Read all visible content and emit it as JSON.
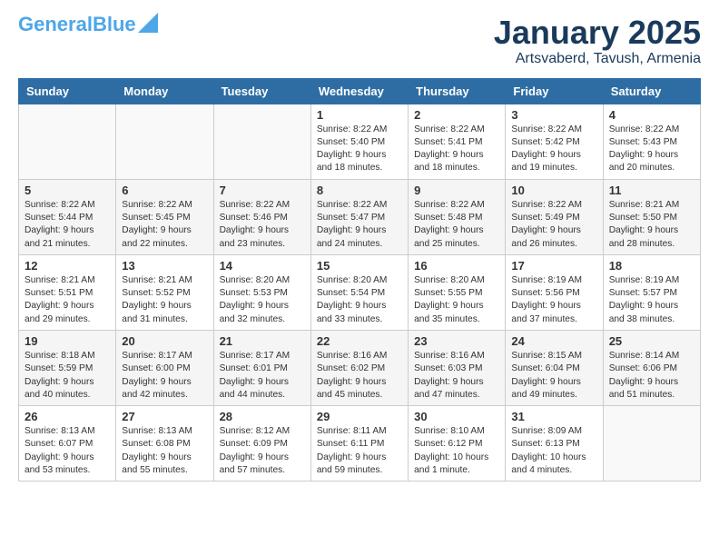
{
  "header": {
    "logo_line1": "General",
    "logo_line2": "Blue",
    "month": "January 2025",
    "location": "Artsvaberd, Tavush, Armenia"
  },
  "weekdays": [
    "Sunday",
    "Monday",
    "Tuesday",
    "Wednesday",
    "Thursday",
    "Friday",
    "Saturday"
  ],
  "weeks": [
    [
      {
        "day": "",
        "text": ""
      },
      {
        "day": "",
        "text": ""
      },
      {
        "day": "",
        "text": ""
      },
      {
        "day": "1",
        "text": "Sunrise: 8:22 AM\nSunset: 5:40 PM\nDaylight: 9 hours\nand 18 minutes."
      },
      {
        "day": "2",
        "text": "Sunrise: 8:22 AM\nSunset: 5:41 PM\nDaylight: 9 hours\nand 18 minutes."
      },
      {
        "day": "3",
        "text": "Sunrise: 8:22 AM\nSunset: 5:42 PM\nDaylight: 9 hours\nand 19 minutes."
      },
      {
        "day": "4",
        "text": "Sunrise: 8:22 AM\nSunset: 5:43 PM\nDaylight: 9 hours\nand 20 minutes."
      }
    ],
    [
      {
        "day": "5",
        "text": "Sunrise: 8:22 AM\nSunset: 5:44 PM\nDaylight: 9 hours\nand 21 minutes."
      },
      {
        "day": "6",
        "text": "Sunrise: 8:22 AM\nSunset: 5:45 PM\nDaylight: 9 hours\nand 22 minutes."
      },
      {
        "day": "7",
        "text": "Sunrise: 8:22 AM\nSunset: 5:46 PM\nDaylight: 9 hours\nand 23 minutes."
      },
      {
        "day": "8",
        "text": "Sunrise: 8:22 AM\nSunset: 5:47 PM\nDaylight: 9 hours\nand 24 minutes."
      },
      {
        "day": "9",
        "text": "Sunrise: 8:22 AM\nSunset: 5:48 PM\nDaylight: 9 hours\nand 25 minutes."
      },
      {
        "day": "10",
        "text": "Sunrise: 8:22 AM\nSunset: 5:49 PM\nDaylight: 9 hours\nand 26 minutes."
      },
      {
        "day": "11",
        "text": "Sunrise: 8:21 AM\nSunset: 5:50 PM\nDaylight: 9 hours\nand 28 minutes."
      }
    ],
    [
      {
        "day": "12",
        "text": "Sunrise: 8:21 AM\nSunset: 5:51 PM\nDaylight: 9 hours\nand 29 minutes."
      },
      {
        "day": "13",
        "text": "Sunrise: 8:21 AM\nSunset: 5:52 PM\nDaylight: 9 hours\nand 31 minutes."
      },
      {
        "day": "14",
        "text": "Sunrise: 8:20 AM\nSunset: 5:53 PM\nDaylight: 9 hours\nand 32 minutes."
      },
      {
        "day": "15",
        "text": "Sunrise: 8:20 AM\nSunset: 5:54 PM\nDaylight: 9 hours\nand 33 minutes."
      },
      {
        "day": "16",
        "text": "Sunrise: 8:20 AM\nSunset: 5:55 PM\nDaylight: 9 hours\nand 35 minutes."
      },
      {
        "day": "17",
        "text": "Sunrise: 8:19 AM\nSunset: 5:56 PM\nDaylight: 9 hours\nand 37 minutes."
      },
      {
        "day": "18",
        "text": "Sunrise: 8:19 AM\nSunset: 5:57 PM\nDaylight: 9 hours\nand 38 minutes."
      }
    ],
    [
      {
        "day": "19",
        "text": "Sunrise: 8:18 AM\nSunset: 5:59 PM\nDaylight: 9 hours\nand 40 minutes."
      },
      {
        "day": "20",
        "text": "Sunrise: 8:17 AM\nSunset: 6:00 PM\nDaylight: 9 hours\nand 42 minutes."
      },
      {
        "day": "21",
        "text": "Sunrise: 8:17 AM\nSunset: 6:01 PM\nDaylight: 9 hours\nand 44 minutes."
      },
      {
        "day": "22",
        "text": "Sunrise: 8:16 AM\nSunset: 6:02 PM\nDaylight: 9 hours\nand 45 minutes."
      },
      {
        "day": "23",
        "text": "Sunrise: 8:16 AM\nSunset: 6:03 PM\nDaylight: 9 hours\nand 47 minutes."
      },
      {
        "day": "24",
        "text": "Sunrise: 8:15 AM\nSunset: 6:04 PM\nDaylight: 9 hours\nand 49 minutes."
      },
      {
        "day": "25",
        "text": "Sunrise: 8:14 AM\nSunset: 6:06 PM\nDaylight: 9 hours\nand 51 minutes."
      }
    ],
    [
      {
        "day": "26",
        "text": "Sunrise: 8:13 AM\nSunset: 6:07 PM\nDaylight: 9 hours\nand 53 minutes."
      },
      {
        "day": "27",
        "text": "Sunrise: 8:13 AM\nSunset: 6:08 PM\nDaylight: 9 hours\nand 55 minutes."
      },
      {
        "day": "28",
        "text": "Sunrise: 8:12 AM\nSunset: 6:09 PM\nDaylight: 9 hours\nand 57 minutes."
      },
      {
        "day": "29",
        "text": "Sunrise: 8:11 AM\nSunset: 6:11 PM\nDaylight: 9 hours\nand 59 minutes."
      },
      {
        "day": "30",
        "text": "Sunrise: 8:10 AM\nSunset: 6:12 PM\nDaylight: 10 hours\nand 1 minute."
      },
      {
        "day": "31",
        "text": "Sunrise: 8:09 AM\nSunset: 6:13 PM\nDaylight: 10 hours\nand 4 minutes."
      },
      {
        "day": "",
        "text": ""
      }
    ]
  ]
}
